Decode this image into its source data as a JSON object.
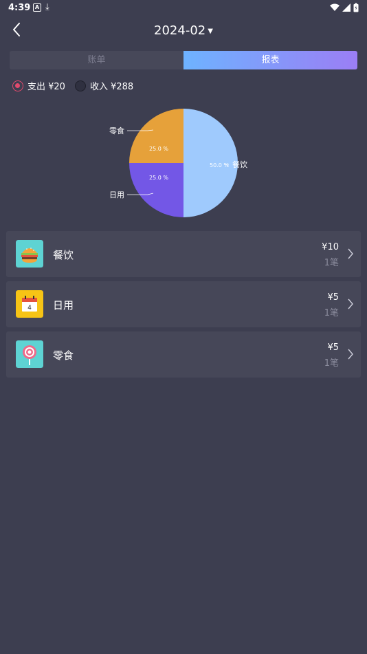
{
  "status": {
    "time": "4:39",
    "a_badge": "A"
  },
  "header": {
    "month": "2024-02"
  },
  "tabs": {
    "bill": "账单",
    "report": "报表"
  },
  "toggle": {
    "expense": "支出 ¥20",
    "income": "收入 ¥288"
  },
  "chart_data": {
    "type": "pie",
    "slices": [
      {
        "label": "餐饮",
        "value": 50.0,
        "pct_label": "50.0 %",
        "color": "#9fcafd"
      },
      {
        "label": "日用",
        "value": 25.0,
        "pct_label": "25.0 %",
        "color": "#7357e6"
      },
      {
        "label": "零食",
        "value": 25.0,
        "pct_label": "25.0 %",
        "color": "#e6a13a"
      }
    ]
  },
  "items": [
    {
      "name": "餐饮",
      "amount": "¥10",
      "count": "1笔",
      "icon": "burger-icon",
      "icon_bg": "#5ed3d3"
    },
    {
      "name": "日用",
      "amount": "¥5",
      "count": "1笔",
      "icon": "calendar-icon",
      "icon_bg": "#f7c415"
    },
    {
      "name": "零食",
      "amount": "¥5",
      "count": "1笔",
      "icon": "lollipop-icon",
      "icon_bg": "#5ed3d3"
    }
  ]
}
